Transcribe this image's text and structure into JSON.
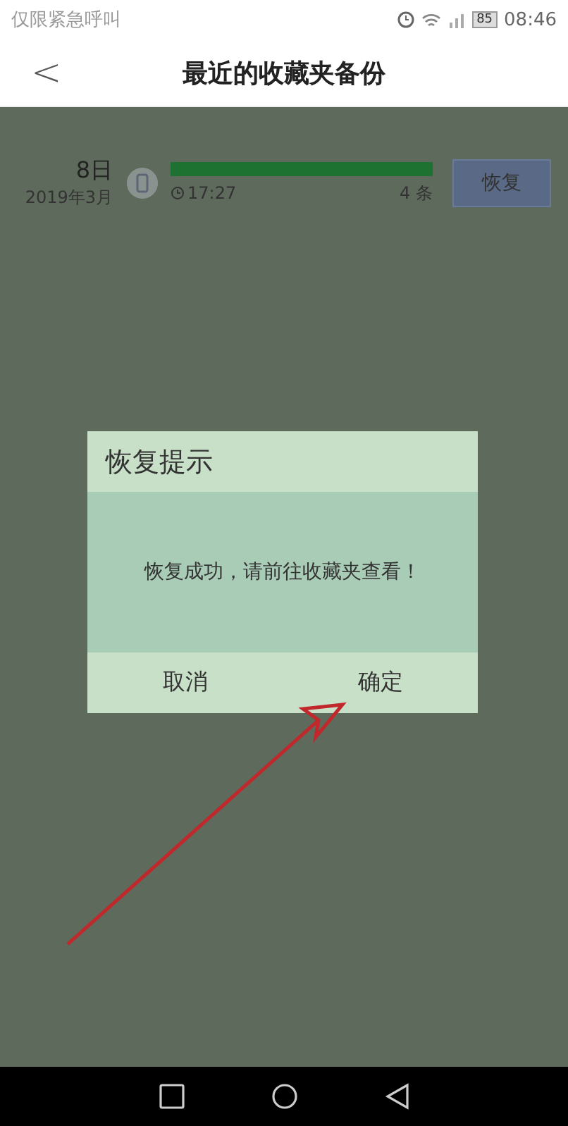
{
  "status_bar": {
    "carrier": "仅限紧急呼叫",
    "battery": "85",
    "time": "08:46"
  },
  "header": {
    "back": "<",
    "title": "最近的收藏夹备份"
  },
  "backups": [
    {
      "day": "8日",
      "month": "2019年3月",
      "level": 1,
      "time": "17:27",
      "count": "4 条",
      "action": "恢复"
    }
  ],
  "dialog": {
    "title": "恢复提示",
    "message": "恢复成功，请前往收藏夹查看！",
    "buttons": [
      {
        "label": "取消"
      },
      {
        "label": "确定"
      }
    ]
  },
  "annotation": {
    "kind": "arrow"
  },
  "nav_bar": {
    "buttons": [
      {
        "kind": "square"
      },
      {
        "kind": "circle"
      },
      {
        "kind": "triangle"
      }
    ]
  }
}
